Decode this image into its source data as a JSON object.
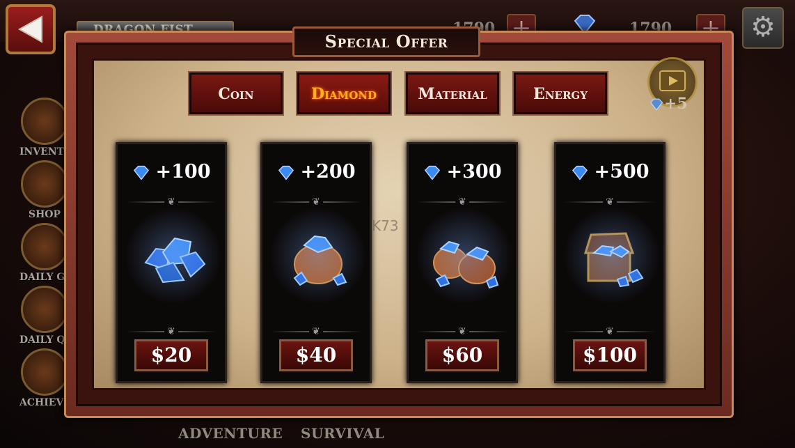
{
  "hud": {
    "player_name": "DRAGON FIST",
    "coins": "1790",
    "diamonds": "1790"
  },
  "sidebar": [
    {
      "label": "INVENTORY"
    },
    {
      "label": "SHOP"
    },
    {
      "label": "DAILY GIFT"
    },
    {
      "label": "DAILY QUEST"
    },
    {
      "label": "ACHIEVEMENT"
    }
  ],
  "bottom_nav": [
    {
      "label": "ADVENTURE"
    },
    {
      "label": "SURVIVAL"
    }
  ],
  "dialog": {
    "title": "Special Offer",
    "tabs": [
      {
        "label": "Coin",
        "active": false
      },
      {
        "label": "Diamond",
        "active": true
      },
      {
        "label": "Material",
        "active": false
      },
      {
        "label": "Energy",
        "active": false
      }
    ],
    "video_reward": "+5",
    "cards": [
      {
        "amount": "+100",
        "price": "$20",
        "icon": "diamond-pile-icon"
      },
      {
        "amount": "+200",
        "price": "$40",
        "icon": "diamond-bag-icon"
      },
      {
        "amount": "+300",
        "price": "$60",
        "icon": "diamond-bags-icon"
      },
      {
        "amount": "+500",
        "price": "$100",
        "icon": "diamond-chest-icon"
      }
    ]
  },
  "watermark": "K73",
  "colors": {
    "active_tab": "#ffb020",
    "tab_bg": "#7a1812",
    "frame": "#a24a3a",
    "parchment": "#d8c29c",
    "gem": "#3a8af0"
  }
}
